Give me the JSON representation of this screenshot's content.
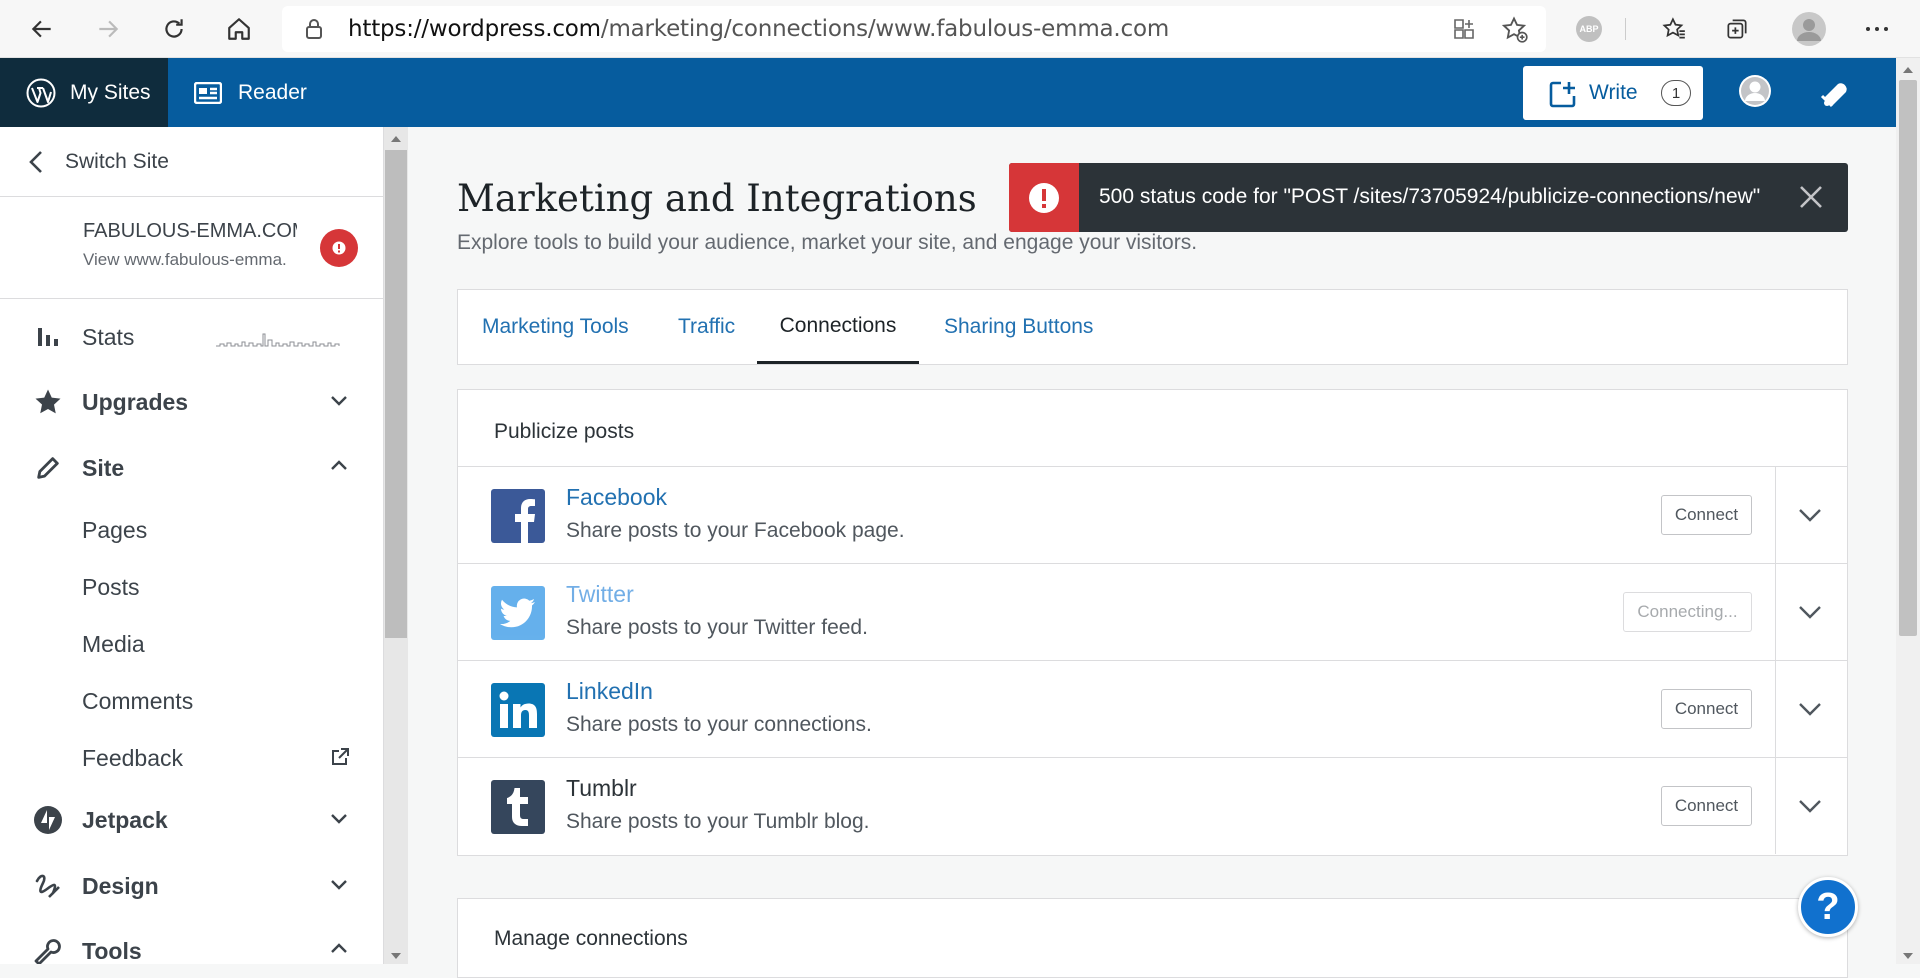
{
  "browser": {
    "url_prefix": "https://wordpress.com",
    "url_path": "/marketing/connections/www.fabulous-emma.com",
    "extension_label": "ABP"
  },
  "masterbar": {
    "my_sites": "My Sites",
    "reader": "Reader",
    "write": "Write",
    "write_count": "1"
  },
  "sidebar": {
    "switch_site": "Switch Site",
    "site_name": "FABULOUS-EMMA.COM",
    "site_url": "View www.fabulous-emma.com",
    "items": {
      "stats": "Stats",
      "upgrades": "Upgrades",
      "site": "Site",
      "pages": "Pages",
      "posts": "Posts",
      "media": "Media",
      "comments": "Comments",
      "feedback": "Feedback",
      "jetpack": "Jetpack",
      "design": "Design",
      "tools": "Tools"
    }
  },
  "page": {
    "title": "Marketing and Integrations",
    "subtitle": "Explore tools to build your audience, market your site, and engage your visitors.",
    "tabs": [
      "Marketing Tools",
      "Traffic",
      "Connections",
      "Sharing Buttons"
    ],
    "active_tab": "Connections"
  },
  "publicize": {
    "header": "Publicize posts",
    "services": [
      {
        "name": "Facebook",
        "desc": "Share posts to your Facebook page.",
        "button": "Connect",
        "color": "#3b5998"
      },
      {
        "name": "Twitter",
        "desc": "Share posts to your Twitter feed.",
        "button": "Connecting...",
        "color": "#4ba3e9"
      },
      {
        "name": "LinkedIn",
        "desc": "Share posts to your connections.",
        "button": "Connect",
        "color": "#0976b4"
      },
      {
        "name": "Tumblr",
        "desc": "Share posts to your Tumblr blog.",
        "button": "Connect",
        "color": "#35465c"
      }
    ]
  },
  "manage": {
    "header": "Manage connections"
  },
  "notice": {
    "message": "500 status code for \"POST /sites/73705924/publicize-connections/new\""
  },
  "help": {
    "label": "?"
  },
  "colors": {
    "masterbar": "#065c9e",
    "my_sites_bg": "#0f2c3d",
    "link": "#2271b1",
    "error": "#d63638",
    "notice_bg": "#2c3338"
  }
}
